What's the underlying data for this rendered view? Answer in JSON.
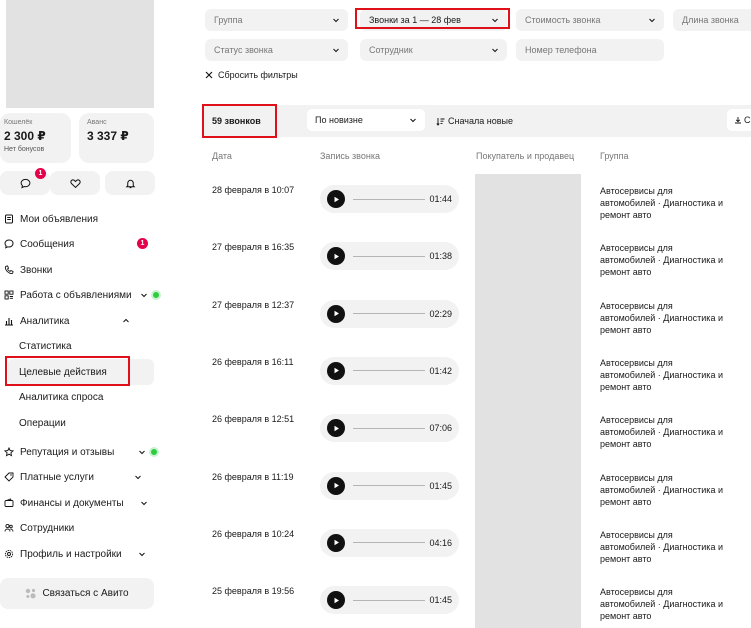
{
  "wallet": {
    "koshelek": {
      "label": "Кошелёк",
      "amount": "2 300 ₽",
      "sub": "Нет бонусов"
    },
    "avans": {
      "label": "Аванс",
      "amount": "3 337 ₽"
    }
  },
  "icons": {
    "messages_badge": "1"
  },
  "nav": {
    "my_ads": "Мои объявления",
    "messages": "Сообщения",
    "messages_badge": "1",
    "calls": "Звонки",
    "work_with_ads": "Работа с объявлениями",
    "analytics": "Аналитика",
    "analytics_sub": [
      "Статистика",
      "Целевые действия",
      "Аналитика спроса",
      "Операции"
    ],
    "reputation": "Репутация и отзывы",
    "paid_services": "Платные услуги",
    "finance": "Финансы и документы",
    "employees": "Сотрудники",
    "profile": "Профиль и настройки",
    "contact": "Связаться с Авито"
  },
  "filters": {
    "group": "Группа",
    "calls_period": "Звонки за 1 — 28 фев",
    "call_cost": "Стоимость звонка",
    "call_length": "Длина звонка",
    "call_status": "Статус звонка",
    "employee": "Сотрудник",
    "phone_placeholder": "Номер телефона",
    "reset": "Сбросить фильтры"
  },
  "toolbar": {
    "count": "59 звонков",
    "sort_value": "По новизне",
    "sort_new": "Сначала новые",
    "export_label": "С"
  },
  "table": {
    "headers": [
      "Дата",
      "Запись звонка",
      "Покупатель и продавец",
      "Группа"
    ],
    "rows": [
      {
        "date": "28 февраля в 10:07",
        "duration": "01:44",
        "group": "Автосервисы для автомобилей · Диагностика и ремонт авто"
      },
      {
        "date": "27 февраля в 16:35",
        "duration": "01:38",
        "group": "Автосервисы для автомобилей · Диагностика и ремонт авто"
      },
      {
        "date": "27 февраля в 12:37",
        "duration": "02:29",
        "group": "Автосервисы для автомобилей · Диагностика и ремонт авто"
      },
      {
        "date": "26 февраля в 16:11",
        "duration": "01:42",
        "group": "Автосервисы для автомобилей · Диагностика и ремонт авто"
      },
      {
        "date": "26 февраля в 12:51",
        "duration": "07:06",
        "group": "Автосервисы для автомобилей · Диагностика и ремонт авто"
      },
      {
        "date": "26 февраля в 11:19",
        "duration": "01:45",
        "group": "Автосервисы для автомобилей · Диагностика и ремонт авто"
      },
      {
        "date": "26 февраля в 10:24",
        "duration": "04:16",
        "group": "Автосервисы для автомобилей · Диагностика и ремонт авто"
      },
      {
        "date": "25 февраля в 19:56",
        "duration": "01:45",
        "group": "Автосервисы для автомобилей · Диагностика и ремонт авто"
      }
    ]
  },
  "colors": {
    "highlight": "#e0101a",
    "badge": "#e5004a",
    "online": "#2ecc40",
    "surface": "#f2f2f2",
    "placeholder": "#e2e2e2"
  }
}
